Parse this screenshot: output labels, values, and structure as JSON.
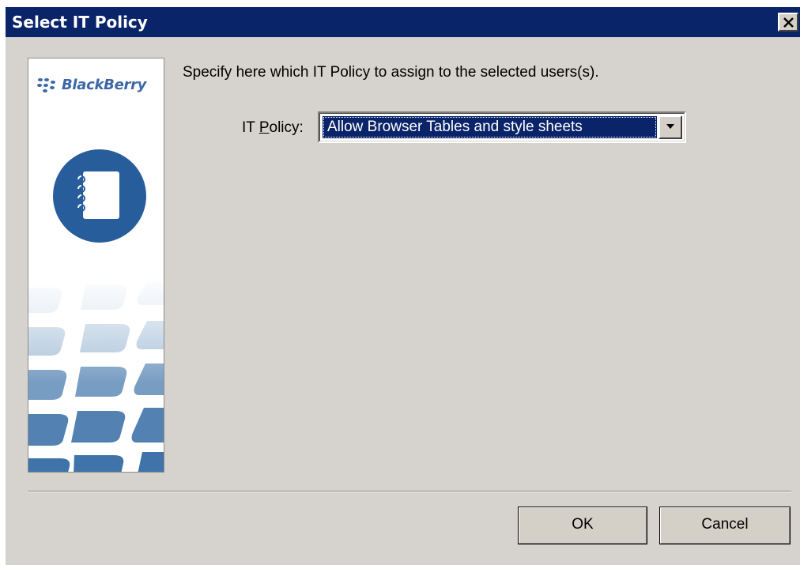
{
  "window": {
    "title": "Select IT Policy",
    "close_icon": "close-icon"
  },
  "side_panel": {
    "logo_text": "BlackBerry",
    "logo_icon": "blackberry-logo-icon",
    "illustration_icon": "address-book-icon"
  },
  "main": {
    "instruction": "Specify here which IT Policy to assign to the selected users(s).",
    "policy_label_prefix": "IT ",
    "policy_label_mnemonic": "P",
    "policy_label_suffix": "olicy:",
    "policy_selected": "Allow Browser Tables and style sheets",
    "dropdown_icon": "chevron-down-icon"
  },
  "buttons": {
    "ok": "OK",
    "cancel": "Cancel"
  },
  "colors": {
    "title_bar": "#0a246a",
    "dialog_bg": "#d6d3ce",
    "brand_blue": "#3b67a6",
    "selection": "#0a246a"
  }
}
